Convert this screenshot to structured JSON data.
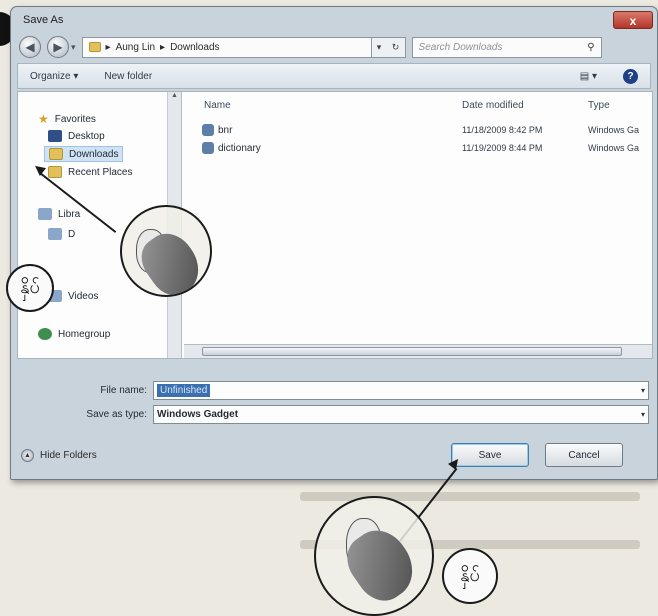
{
  "window": {
    "title": "Save As",
    "close_label": "x"
  },
  "address": {
    "crumb_user": "Aung Lin",
    "crumb_folder": "Downloads",
    "separator": "▸",
    "search_placeholder": "Search Downloads"
  },
  "toolbar": {
    "organize_label": "Organize ▾",
    "new_folder_label": "New folder",
    "views_label": "▤ ▾",
    "help_label": "?"
  },
  "nav": {
    "favorites": "Favorites",
    "desktop": "Desktop",
    "downloads": "Downloads",
    "recent_places": "Recent Places",
    "libraries_partial": "Libra",
    "documents_partial": "D",
    "videos": "Videos",
    "homegroup": "Homegroup"
  },
  "columns": {
    "name": "Name",
    "date_modified": "Date modified",
    "type": "Type"
  },
  "files": [
    {
      "name": "bnr",
      "date": "11/18/2009 8:42 PM",
      "type": "Windows Ga"
    },
    {
      "name": "dictionary",
      "date": "11/19/2009 8:44 PM",
      "type": "Windows Ga"
    }
  ],
  "fields": {
    "file_name_label": "File name:",
    "file_name_value": "Unfinished",
    "save_type_label": "Save as type:",
    "save_type_value": "Windows Gadget"
  },
  "footer": {
    "hide_folders": "Hide Folders",
    "save_button": "Save",
    "cancel_button": "Cancel"
  },
  "callouts": {
    "label_text": "နှိပ်"
  }
}
